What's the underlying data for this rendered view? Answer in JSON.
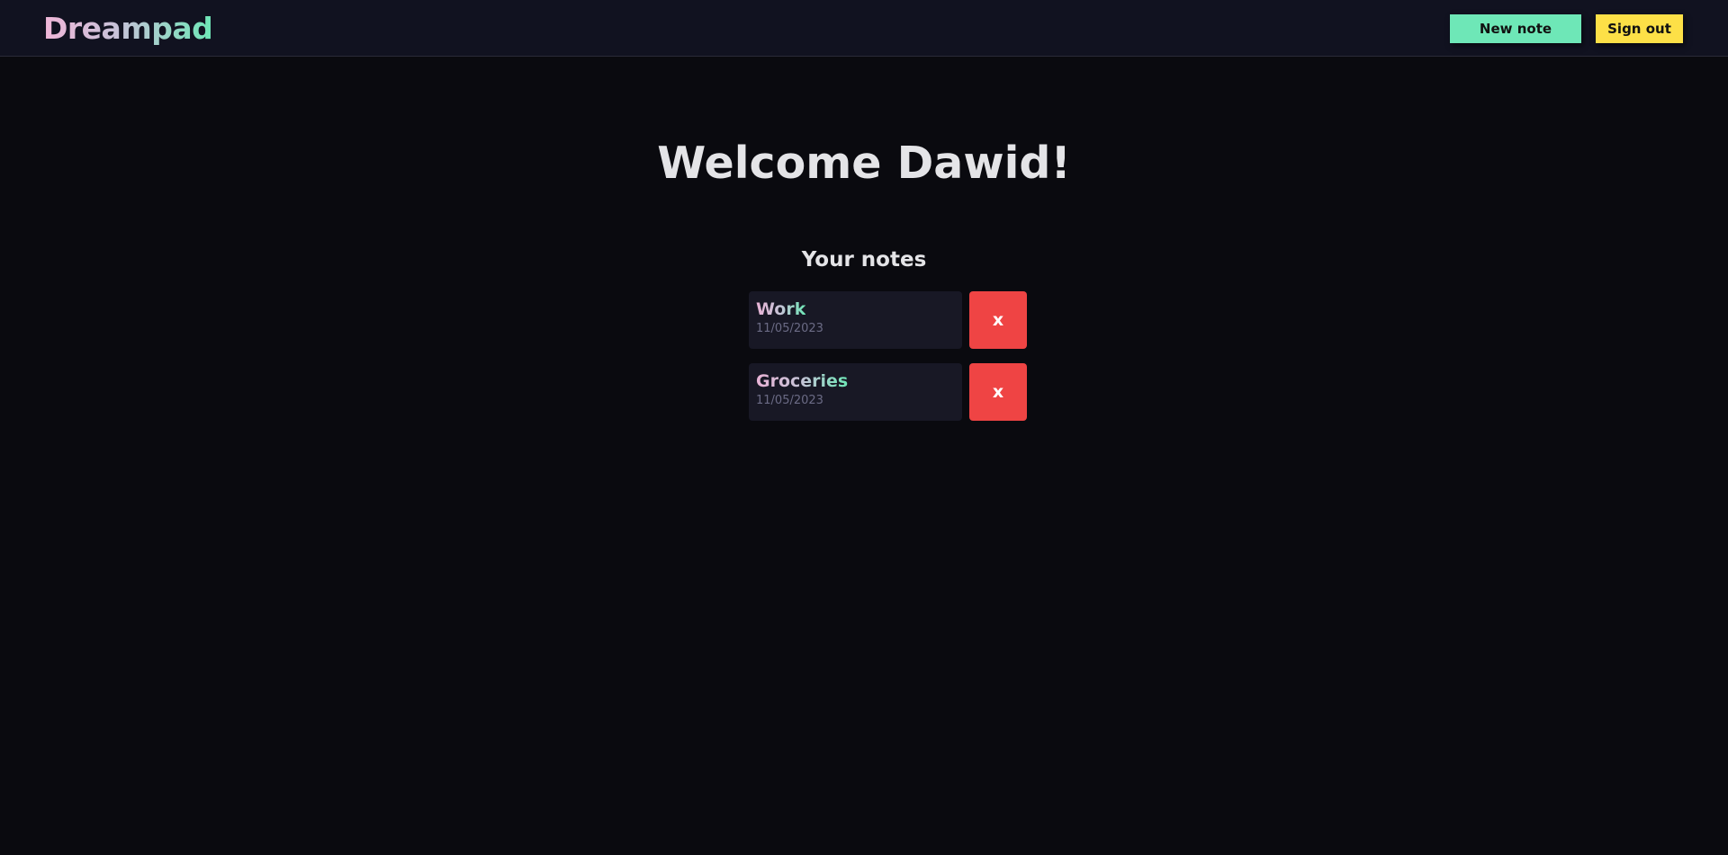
{
  "app": {
    "logo": "Dreampad"
  },
  "header": {
    "new_note_label": "New note",
    "sign_out_label": "Sign out"
  },
  "main": {
    "welcome": "Welcome Dawid!",
    "notes_heading": "Your notes",
    "notes": [
      {
        "title": "Work",
        "date": "11/05/2023",
        "delete_label": "x"
      },
      {
        "title": "Groceries",
        "date": "11/05/2023",
        "delete_label": "x"
      }
    ]
  },
  "colors": {
    "background": "#0a0a0f",
    "header_background": "#111220",
    "accent_green": "#6ee7b7",
    "accent_yellow": "#fde047",
    "accent_pink": "#f0b6d8",
    "delete_red": "#ef4444",
    "card_background": "#181825"
  }
}
